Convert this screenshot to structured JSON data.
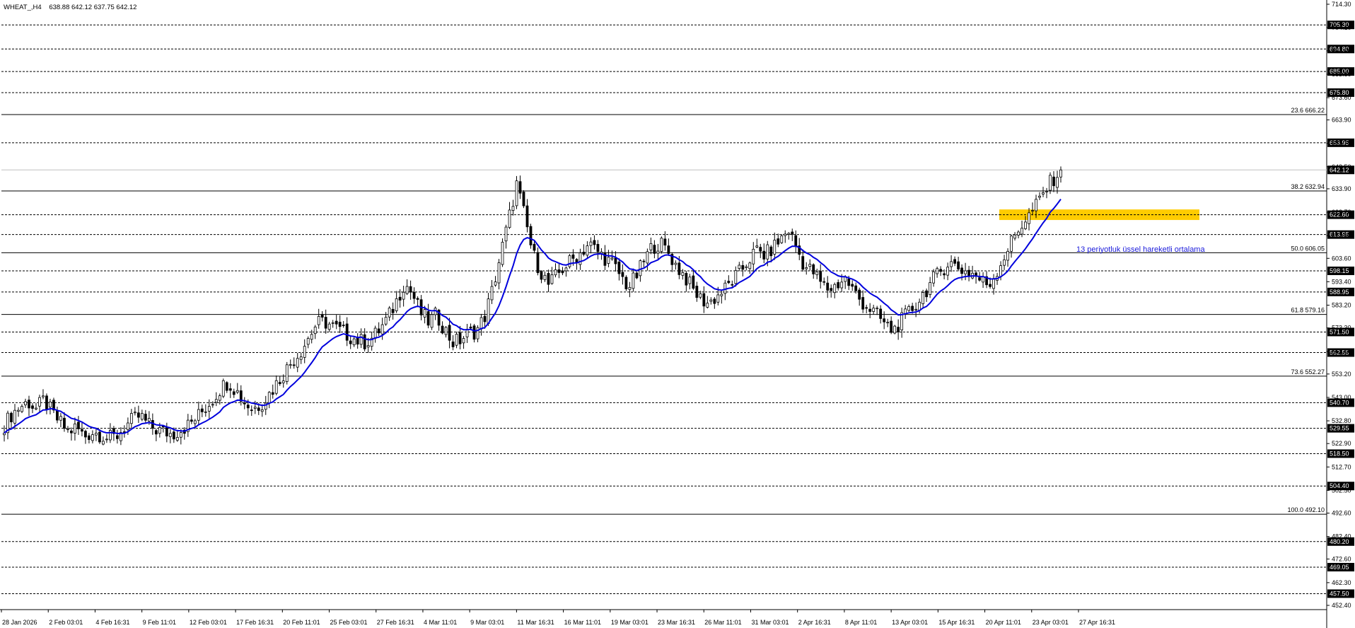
{
  "header": {
    "symbol": "WHEAT_,H4",
    "ohlc": "638.88 642.12 637.75 642.12"
  },
  "colors": {
    "ema": "#0000dd",
    "zone": "#ffcc00",
    "candle": "#000000",
    "price_line": "#c0c0c0",
    "annotation": "#1a1adb"
  },
  "chart_data": {
    "type": "candlestick",
    "symbol": "WHEAT_",
    "timeframe": "H4",
    "ylim": [
      452.4,
      714.3
    ],
    "y_ticks": [
      "714.30",
      "704.10",
      "694.00",
      "683.80",
      "673.60",
      "663.90",
      "653.70",
      "643.50",
      "633.90",
      "623.70",
      "613.50",
      "603.60",
      "593.40",
      "583.20",
      "573.30",
      "563.00",
      "553.20",
      "543.00",
      "532.80",
      "522.90",
      "512.70",
      "502.50",
      "492.60",
      "482.40",
      "472.60",
      "462.30",
      "452.40"
    ],
    "x_labels": [
      "28 Jan 2026",
      "2 Feb 03:01",
      "4 Feb 16:31",
      "9 Feb 11:01",
      "12 Feb 03:01",
      "17 Feb 16:31",
      "20 Feb 11:01",
      "25 Feb 03:01",
      "27 Feb 16:31",
      "4 Mar 11:01",
      "9 Mar 03:01",
      "11 Mar 16:31",
      "16 Mar 11:01",
      "19 Mar 03:01",
      "23 Mar 16:31",
      "26 Mar 11:01",
      "31 Mar 03:01",
      "2 Apr 16:31",
      "8 Apr 11:01",
      "13 Apr 03:01",
      "15 Apr 16:31",
      "20 Apr 11:01",
      "23 Apr 03:01",
      "27 Apr 16:31"
    ],
    "last_price": 642.12,
    "horizontal_levels": [
      {
        "value": 705.3,
        "label": "705.30"
      },
      {
        "value": 694.8,
        "label": "694.80"
      },
      {
        "value": 685.0,
        "label": "685.00"
      },
      {
        "value": 675.8,
        "label": "675.80"
      },
      {
        "value": 653.95,
        "label": "653.95"
      },
      {
        "value": 622.6,
        "label": "622.60"
      },
      {
        "value": 613.95,
        "label": "613.95"
      },
      {
        "value": 598.15,
        "label": "598.15"
      },
      {
        "value": 588.95,
        "label": "588.95"
      },
      {
        "value": 571.5,
        "label": "571.50"
      },
      {
        "value": 562.55,
        "label": "562.55"
      },
      {
        "value": 540.7,
        "label": "540.70"
      },
      {
        "value": 529.55,
        "label": "529.55"
      },
      {
        "value": 518.5,
        "label": "518.50"
      },
      {
        "value": 504.4,
        "label": "504.40"
      },
      {
        "value": 480.2,
        "label": "480.20"
      },
      {
        "value": 469.05,
        "label": "469.05"
      },
      {
        "value": 457.5,
        "label": "457.50"
      }
    ],
    "fibonacci": [
      {
        "label": "23.6 666.22",
        "value": 666.22
      },
      {
        "label": "38.2 632.94",
        "value": 632.94
      },
      {
        "label": "50.0 606.05",
        "value": 606.05
      },
      {
        "label": "61.8 579.16",
        "value": 579.16
      },
      {
        "label": "73.6 552.27",
        "value": 552.27
      },
      {
        "label": "100.0 492.10",
        "value": 492.1
      }
    ],
    "zone": {
      "low": 620.3,
      "high": 624.9
    },
    "annotation": "13 periyotluk üssel hareketli ortalama",
    "series": [
      {
        "t": 0,
        "c": 531
      },
      {
        "t": 1,
        "c": 536
      },
      {
        "t": 2,
        "c": 539
      },
      {
        "t": 3,
        "c": 541
      },
      {
        "t": 4,
        "c": 538
      },
      {
        "t": 5,
        "c": 542
      },
      {
        "t": 6,
        "c": 536
      },
      {
        "t": 7,
        "c": 532
      },
      {
        "t": 8,
        "c": 528
      },
      {
        "t": 9,
        "c": 530
      },
      {
        "t": 10,
        "c": 526
      },
      {
        "t": 11,
        "c": 528
      },
      {
        "t": 12,
        "c": 527
      },
      {
        "t": 13,
        "c": 525
      },
      {
        "t": 14,
        "c": 526
      },
      {
        "t": 15,
        "c": 530
      },
      {
        "t": 16,
        "c": 533
      },
      {
        "t": 17,
        "c": 535
      },
      {
        "t": 18,
        "c": 531
      },
      {
        "t": 19,
        "c": 529
      },
      {
        "t": 20,
        "c": 528
      },
      {
        "t": 21,
        "c": 527
      },
      {
        "t": 22,
        "c": 529
      },
      {
        "t": 23,
        "c": 531
      },
      {
        "t": 24,
        "c": 534
      },
      {
        "t": 25,
        "c": 538
      },
      {
        "t": 26,
        "c": 542
      },
      {
        "t": 27,
        "c": 547
      },
      {
        "t": 28,
        "c": 550
      },
      {
        "t": 29,
        "c": 546
      },
      {
        "t": 30,
        "c": 541
      },
      {
        "t": 31,
        "c": 538
      },
      {
        "t": 32,
        "c": 540
      },
      {
        "t": 33,
        "c": 544
      },
      {
        "t": 34,
        "c": 549
      },
      {
        "t": 35,
        "c": 554
      },
      {
        "t": 36,
        "c": 559
      },
      {
        "t": 37,
        "c": 563
      },
      {
        "t": 38,
        "c": 569
      },
      {
        "t": 39,
        "c": 575
      },
      {
        "t": 40,
        "c": 576
      },
      {
        "t": 41,
        "c": 574
      },
      {
        "t": 42,
        "c": 572
      },
      {
        "t": 43,
        "c": 570
      },
      {
        "t": 44,
        "c": 568
      },
      {
        "t": 45,
        "c": 567
      },
      {
        "t": 46,
        "c": 569
      },
      {
        "t": 47,
        "c": 573
      },
      {
        "t": 48,
        "c": 578
      },
      {
        "t": 49,
        "c": 585
      },
      {
        "t": 50,
        "c": 593
      },
      {
        "t": 51,
        "c": 588
      },
      {
        "t": 52,
        "c": 580
      },
      {
        "t": 53,
        "c": 576
      },
      {
        "t": 54,
        "c": 579
      },
      {
        "t": 55,
        "c": 573
      },
      {
        "t": 56,
        "c": 567
      },
      {
        "t": 57,
        "c": 568
      },
      {
        "t": 58,
        "c": 571
      },
      {
        "t": 59,
        "c": 572
      },
      {
        "t": 60,
        "c": 578
      },
      {
        "t": 61,
        "c": 590
      },
      {
        "t": 62,
        "c": 605
      },
      {
        "t": 63,
        "c": 620
      },
      {
        "t": 64,
        "c": 636
      },
      {
        "t": 65,
        "c": 622
      },
      {
        "t": 66,
        "c": 606
      },
      {
        "t": 67,
        "c": 598
      },
      {
        "t": 68,
        "c": 592
      },
      {
        "t": 69,
        "c": 596
      },
      {
        "t": 70,
        "c": 600
      },
      {
        "t": 71,
        "c": 603
      },
      {
        "t": 72,
        "c": 606
      },
      {
        "t": 73,
        "c": 610
      },
      {
        "t": 74,
        "c": 607
      },
      {
        "t": 75,
        "c": 604
      },
      {
        "t": 76,
        "c": 601
      },
      {
        "t": 77,
        "c": 596
      },
      {
        "t": 78,
        "c": 591
      },
      {
        "t": 79,
        "c": 596
      },
      {
        "t": 80,
        "c": 603
      },
      {
        "t": 81,
        "c": 609
      },
      {
        "t": 82,
        "c": 610
      },
      {
        "t": 83,
        "c": 606
      },
      {
        "t": 84,
        "c": 600
      },
      {
        "t": 85,
        "c": 596
      },
      {
        "t": 86,
        "c": 590
      },
      {
        "t": 87,
        "c": 586
      },
      {
        "t": 88,
        "c": 584
      },
      {
        "t": 89,
        "c": 587
      },
      {
        "t": 90,
        "c": 590
      },
      {
        "t": 91,
        "c": 594
      },
      {
        "t": 92,
        "c": 598
      },
      {
        "t": 93,
        "c": 603
      },
      {
        "t": 94,
        "c": 607
      },
      {
        "t": 95,
        "c": 605
      },
      {
        "t": 96,
        "c": 608
      },
      {
        "t": 97,
        "c": 612
      },
      {
        "t": 98,
        "c": 616
      },
      {
        "t": 99,
        "c": 608
      },
      {
        "t": 100,
        "c": 600
      },
      {
        "t": 101,
        "c": 598
      },
      {
        "t": 102,
        "c": 593
      },
      {
        "t": 103,
        "c": 590
      },
      {
        "t": 104,
        "c": 592
      },
      {
        "t": 105,
        "c": 595
      },
      {
        "t": 106,
        "c": 590
      },
      {
        "t": 107,
        "c": 585
      },
      {
        "t": 108,
        "c": 582
      },
      {
        "t": 109,
        "c": 579
      },
      {
        "t": 110,
        "c": 575
      },
      {
        "t": 111,
        "c": 572
      },
      {
        "t": 112,
        "c": 576
      },
      {
        "t": 113,
        "c": 580
      },
      {
        "t": 114,
        "c": 584
      },
      {
        "t": 115,
        "c": 589
      },
      {
        "t": 116,
        "c": 594
      },
      {
        "t": 117,
        "c": 598
      },
      {
        "t": 118,
        "c": 602
      },
      {
        "t": 119,
        "c": 600
      },
      {
        "t": 120,
        "c": 598
      },
      {
        "t": 121,
        "c": 597
      },
      {
        "t": 122,
        "c": 594
      },
      {
        "t": 123,
        "c": 592
      },
      {
        "t": 124,
        "c": 598
      },
      {
        "t": 125,
        "c": 605
      },
      {
        "t": 126,
        "c": 612
      },
      {
        "t": 127,
        "c": 618
      },
      {
        "t": 128,
        "c": 622
      },
      {
        "t": 129,
        "c": 627
      },
      {
        "t": 130,
        "c": 633
      },
      {
        "t": 131,
        "c": 638
      },
      {
        "t": 132,
        "c": 642.12
      }
    ]
  }
}
